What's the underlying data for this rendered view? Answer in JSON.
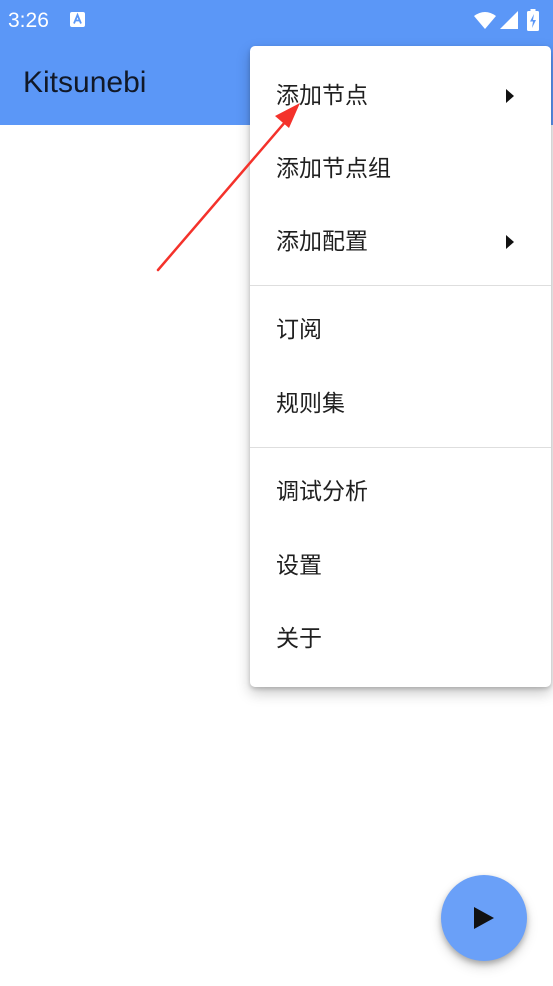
{
  "status_bar": {
    "time": "3:26",
    "icons": [
      "notification-a-icon",
      "wifi-icon",
      "signal-icon",
      "battery-charging-icon"
    ]
  },
  "app_bar": {
    "title": "Kitsunebi",
    "color": "#5b97f7"
  },
  "menu": {
    "items": [
      {
        "label": "添加节点",
        "has_submenu": true
      },
      {
        "label": "添加节点组",
        "has_submenu": false
      },
      {
        "label": "添加配置",
        "has_submenu": true
      },
      {
        "label": "订阅",
        "has_submenu": false
      },
      {
        "label": "规则集",
        "has_submenu": false
      },
      {
        "label": "调试分析",
        "has_submenu": false
      },
      {
        "label": "设置",
        "has_submenu": false
      },
      {
        "label": "关于",
        "has_submenu": false
      }
    ]
  },
  "fab": {
    "icon": "play-icon",
    "color": "#6aa0f8"
  },
  "annotation": {
    "type": "arrow",
    "color": "#f4322b"
  }
}
